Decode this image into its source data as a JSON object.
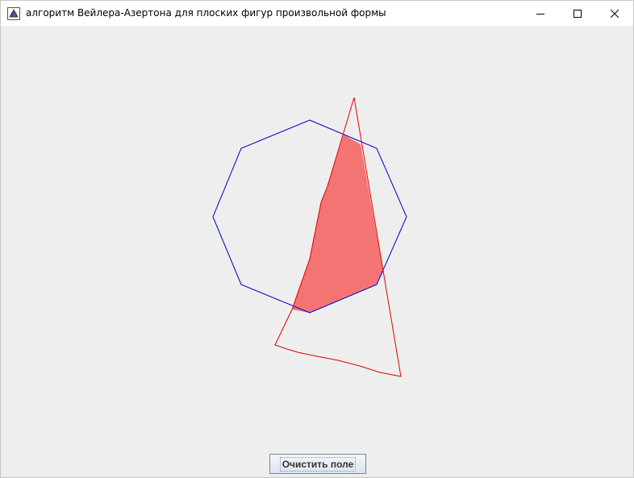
{
  "window": {
    "title": "алгоритм Вейлера-Азертона для плоских фигур произвольной формы",
    "icons": {
      "app": "java-app-icon",
      "minimize": "minimize-icon",
      "maximize": "maximize-icon",
      "close": "close-icon"
    }
  },
  "canvas": {
    "colors": {
      "polygon_outline": "#0000cc",
      "clip_outline": "#e00000",
      "intersection_fill": "#f47474"
    }
  },
  "toolbar": {
    "clear_label": "Очистить поле"
  }
}
